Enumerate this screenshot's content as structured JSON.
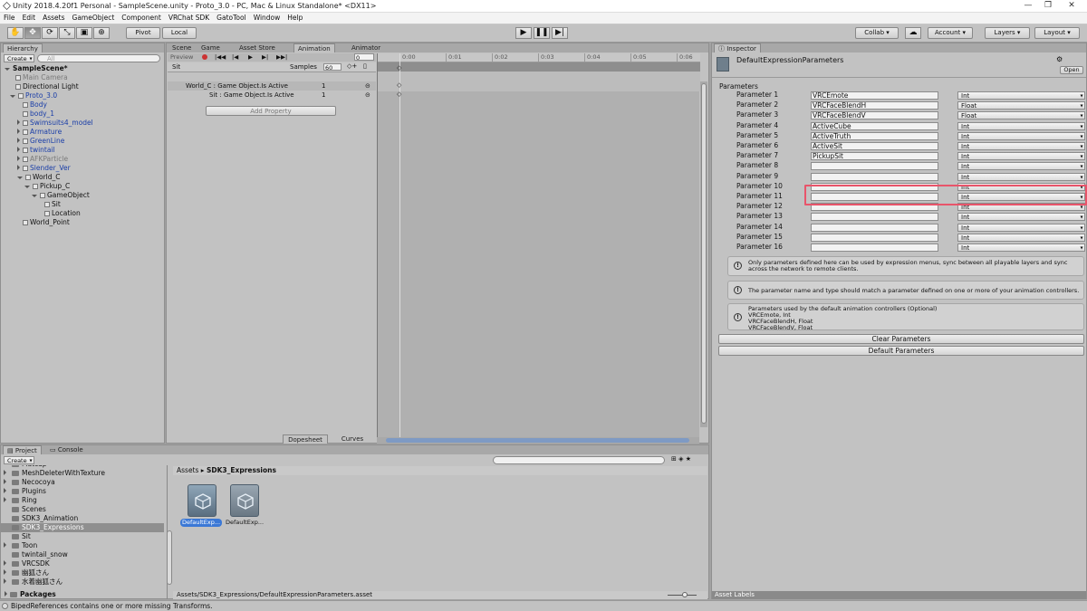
{
  "window": {
    "title": "Unity 2018.4.20f1 Personal - SampleScene.unity - Proto_3.0 - PC, Mac & Linux Standalone* <DX11>"
  },
  "menu": [
    "File",
    "Edit",
    "Assets",
    "GameObject",
    "Component",
    "VRChat SDK",
    "GatoTool",
    "Window",
    "Help"
  ],
  "toolbar": {
    "pivot": "Pivot",
    "local": "Local",
    "collab": "Collab ▾",
    "account": "Account",
    "layers": "Layers",
    "layout": "Layout"
  },
  "hierarchy": {
    "tab": "Hierarchy",
    "create": "Create",
    "search": "All",
    "scene": "SampleScene*",
    "items": [
      {
        "label": "Main Camera",
        "indent": 1,
        "style": "gray",
        "arrow": ""
      },
      {
        "label": "Directional Light",
        "indent": 1,
        "style": "",
        "arrow": ""
      },
      {
        "label": "Proto_3.0",
        "indent": 1,
        "style": "blue",
        "arrow": "d"
      },
      {
        "label": "Body",
        "indent": 2,
        "style": "blue",
        "arrow": ""
      },
      {
        "label": "body_1",
        "indent": 2,
        "style": "blue",
        "arrow": ""
      },
      {
        "label": "Swimsuits4_model",
        "indent": 2,
        "style": "blue",
        "arrow": "r"
      },
      {
        "label": "Armature",
        "indent": 2,
        "style": "blue",
        "arrow": "r"
      },
      {
        "label": "GreenLine",
        "indent": 2,
        "style": "blue",
        "arrow": "r"
      },
      {
        "label": "twintail",
        "indent": 2,
        "style": "blue",
        "arrow": "r"
      },
      {
        "label": "AFKParticle",
        "indent": 2,
        "style": "gray",
        "arrow": "r"
      },
      {
        "label": "Slender_Ver",
        "indent": 2,
        "style": "blue",
        "arrow": "r"
      },
      {
        "label": "World_C",
        "indent": 2,
        "style": "",
        "arrow": "d"
      },
      {
        "label": "Pickup_C",
        "indent": 3,
        "style": "",
        "arrow": "d"
      },
      {
        "label": "GameObject",
        "indent": 4,
        "style": "",
        "arrow": "d"
      },
      {
        "label": "Sit",
        "indent": 5,
        "style": "",
        "arrow": ""
      },
      {
        "label": "Location",
        "indent": 5,
        "style": "",
        "arrow": ""
      },
      {
        "label": "World_Point",
        "indent": 2,
        "style": "",
        "arrow": ""
      }
    ]
  },
  "center_tabs": [
    "Scene",
    "Game",
    "Asset Store",
    "Animation",
    "Animator"
  ],
  "animation": {
    "preview": "Preview",
    "frame": "0",
    "clip": "Sit",
    "samples_label": "Samples",
    "samples": "60",
    "properties": [
      {
        "label": "World_C : Game Object.Is Active",
        "value": "1"
      },
      {
        "label": "Sit : Game Object.Is Active",
        "value": "1"
      }
    ],
    "add_property": "Add Property",
    "timeline": [
      "0:00",
      "0:01",
      "0:02",
      "0:03",
      "0:04",
      "0:05",
      "0:06"
    ],
    "dopesheet": "Dopesheet",
    "curves": "Curves"
  },
  "inspector": {
    "tab": "Inspector",
    "asset_name": "DefaultExpressionParameters",
    "open": "Open",
    "section": "Parameters",
    "params": [
      {
        "label": "Parameter 1",
        "name": "VRCEmote",
        "type": "Int"
      },
      {
        "label": "Parameter 2",
        "name": "VRCFaceBlendH",
        "type": "Float"
      },
      {
        "label": "Parameter 3",
        "name": "VRCFaceBlendV",
        "type": "Float"
      },
      {
        "label": "Parameter 4",
        "name": "ActiveCube",
        "type": "Int"
      },
      {
        "label": "Parameter 5",
        "name": "ActiveTruth",
        "type": "Int"
      },
      {
        "label": "Parameter 6",
        "name": "ActiveSit",
        "type": "Int"
      },
      {
        "label": "Parameter 7",
        "name": "PickupSit",
        "type": "Int"
      },
      {
        "label": "Parameter 8",
        "name": "",
        "type": "Int"
      },
      {
        "label": "Parameter 9",
        "name": "",
        "type": "Int"
      },
      {
        "label": "Parameter 10",
        "name": "",
        "type": "Int"
      },
      {
        "label": "Parameter 11",
        "name": "",
        "type": "Int"
      },
      {
        "label": "Parameter 12",
        "name": "",
        "type": "Int"
      },
      {
        "label": "Parameter 13",
        "name": "",
        "type": "Int"
      },
      {
        "label": "Parameter 14",
        "name": "",
        "type": "Int"
      },
      {
        "label": "Parameter 15",
        "name": "",
        "type": "Int"
      },
      {
        "label": "Parameter 16",
        "name": "",
        "type": "Int"
      }
    ],
    "help1": "Only parameters defined here can be used by expression menus, sync between all playable layers and sync across the network to remote clients.",
    "help2": "The parameter name and type should match a parameter defined on one or more of your animation controllers.",
    "help3": [
      "Parameters used by the default animation controllers (Optional)",
      "VRCEmote, Int",
      "VRCFaceBlendH, Float",
      "VRCFaceBlendV, Float"
    ],
    "clear": "Clear Parameters",
    "defaults": "Default Parameters",
    "asset_labels": "Asset Labels",
    "highlight_color": "#e8546a"
  },
  "project": {
    "tabs": [
      "Project",
      "Console"
    ],
    "create": "Create",
    "folders": [
      "Matcap",
      "MeshDeleterWithTexture",
      "Necocoya",
      "Plugins",
      "Ring",
      "Scenes",
      "SDK3_Animation",
      "SDK3_Expressions",
      "Sit",
      "Toon",
      "twintail_snow",
      "VRCSDK",
      "幽狐さん",
      "水着幽狐さん"
    ],
    "selected_folder": "SDK3_Expressions",
    "packages": "Packages",
    "breadcrumb": [
      "Assets",
      "SDK3_Expressions"
    ],
    "assets": [
      {
        "label": "DefaultExp..."
      },
      {
        "label": "DefaultExp..."
      }
    ],
    "path": "Assets/SDK3_Expressions/DefaultExpressionParameters.asset"
  },
  "status": "BipedReferences contains one or more missing Transforms."
}
